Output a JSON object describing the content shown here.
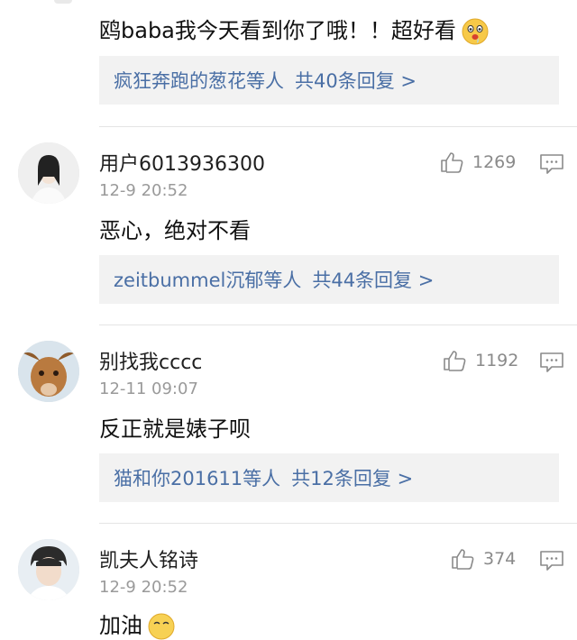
{
  "comments": [
    {
      "text": "鸥baba我今天看到你了哦！！超好看",
      "reply": {
        "who": "疯狂奔跑的葱花等人",
        "count": "共40条回复 >"
      }
    },
    {
      "username": "用户6013936300",
      "time": "12-9 20:52",
      "likes": "1269",
      "text": "恶心，绝对不看",
      "reply": {
        "who": "zeitbummel沉郁等人",
        "count": "共44条回复 >"
      }
    },
    {
      "username": "别找我cccc",
      "time": "12-11 09:07",
      "likes": "1192",
      "text": "反正就是婊子呗",
      "reply": {
        "who": "猫和你201611等人",
        "count": "共12条回复 >"
      }
    },
    {
      "username": "凯夫人铭诗",
      "time": "12-9 20:52",
      "likes": "374",
      "text": "加油"
    }
  ],
  "icons": {
    "like": "thumbs-up-icon",
    "reply": "comment-bubble-icon",
    "emoji_drool": "drooling-face-emoji",
    "emoji_blush": "blushing-face-emoji"
  },
  "colors": {
    "link": "#4a6fa5",
    "reply_bg": "#f2f2f2",
    "meta": "#9a9a9a"
  }
}
